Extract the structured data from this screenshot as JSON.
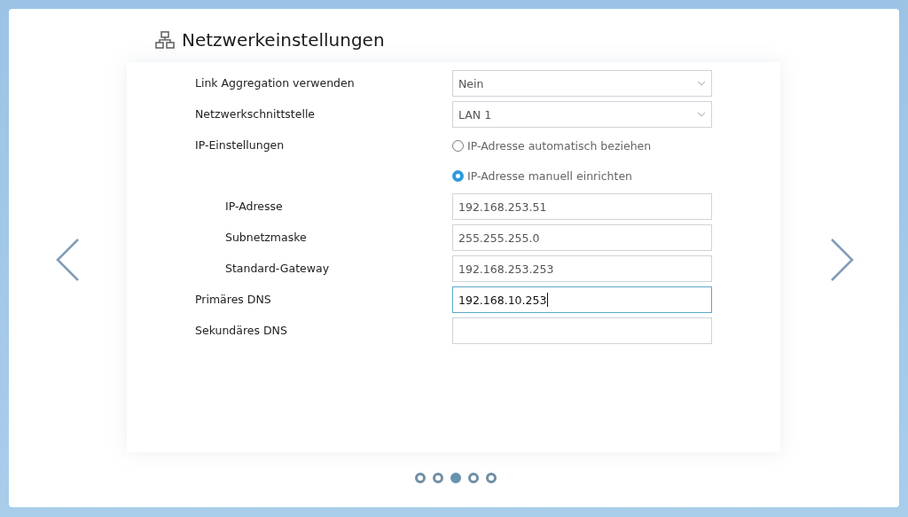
{
  "title": "Netzwerkeinstellungen",
  "rows": [
    {
      "kind": "select",
      "label": "Link Aggregation verwenden",
      "value": "Nein"
    },
    {
      "kind": "select",
      "label": "Netzwerkschnittstelle",
      "value": "LAN 1"
    },
    {
      "kind": "radio",
      "label": "IP-Einstellungen",
      "options": [
        {
          "label": "IP-Adresse automatisch beziehen",
          "selected": false
        },
        {
          "label": "IP-Adresse manuell einrichten",
          "selected": true
        }
      ],
      "children": [
        {
          "kind": "text",
          "label": "IP-Adresse",
          "value": "192.168.253.51",
          "focused": false
        },
        {
          "kind": "text",
          "label": "Subnetzmaske",
          "value": "255.255.255.0",
          "focused": false
        },
        {
          "kind": "text",
          "label": "Standard-Gateway",
          "value": "192.168.253.253",
          "focused": false
        }
      ]
    },
    {
      "kind": "text",
      "label": "Primäres DNS",
      "value": "192.168.10.253",
      "focused": true
    },
    {
      "kind": "text",
      "label": "Sekundäres DNS",
      "value": "",
      "focused": false
    }
  ],
  "pager": [
    {
      "selected": false
    },
    {
      "selected": false
    },
    {
      "selected": true
    },
    {
      "selected": false
    },
    {
      "selected": false
    }
  ]
}
